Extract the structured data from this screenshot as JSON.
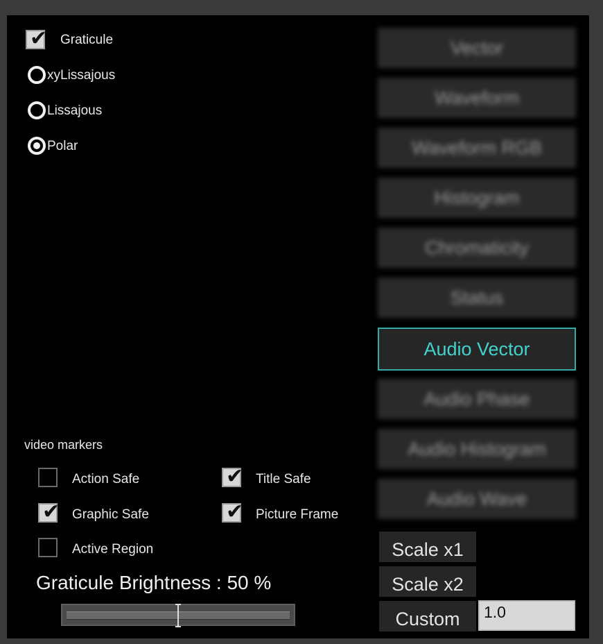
{
  "display_options": {
    "graticule": {
      "label": "Graticule",
      "checked": true
    },
    "modes": [
      {
        "label": "xyLissajous",
        "selected": false
      },
      {
        "label": "Lissajous",
        "selected": false
      },
      {
        "label": "Polar",
        "selected": true
      }
    ]
  },
  "video_markers": {
    "heading": "video markers",
    "items": [
      {
        "label": "Action Safe",
        "checked": false
      },
      {
        "label": "Title Safe",
        "checked": true
      },
      {
        "label": "Graphic Safe",
        "checked": true
      },
      {
        "label": "Picture Frame",
        "checked": true
      },
      {
        "label": "Active Region",
        "checked": false
      }
    ]
  },
  "brightness": {
    "label": "Graticule Brightness : 50 %",
    "value_percent": 50
  },
  "view_buttons": [
    {
      "label": "Vector",
      "active": false
    },
    {
      "label": "Waveform",
      "active": false
    },
    {
      "label": "Waveform RGB",
      "active": false
    },
    {
      "label": "Histogram",
      "active": false
    },
    {
      "label": "Chromaticity",
      "active": false
    },
    {
      "label": "Status",
      "active": false
    },
    {
      "label": "Audio Vector",
      "active": true
    },
    {
      "label": "Audio Phase",
      "active": false
    },
    {
      "label": "Audio Histogram",
      "active": false
    },
    {
      "label": "Audio Wave",
      "active": false
    }
  ],
  "scale": {
    "x1_label": "Scale x1",
    "x2_label": "Scale x2",
    "custom_label": "Custom",
    "custom_value": "1.0"
  },
  "colors": {
    "accent": "#43d3cd",
    "accent_border": "#33aaa4",
    "panel": "#000000",
    "frame": "#3a3a3a"
  }
}
